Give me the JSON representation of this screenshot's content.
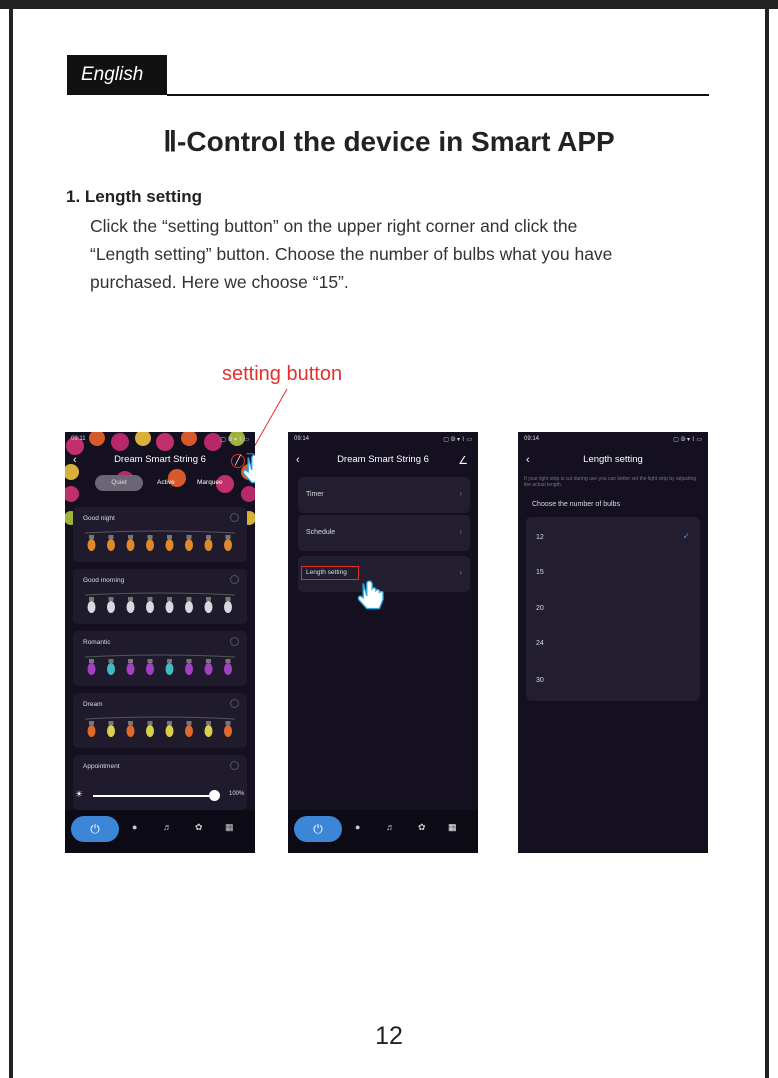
{
  "header": {
    "language": "English",
    "title": "Ⅱ-Control the device in Smart APP"
  },
  "section": {
    "heading": "1. Length setting",
    "lines": [
      "Click the  “setting button” on the upper right corner and click the",
      "“Length setting” button. Choose the number of bulbs what you have",
      "purchased. Here we choose  “15”."
    ]
  },
  "callout": {
    "label": "setting button"
  },
  "phone1": {
    "time": "09:11",
    "status_right": "▢ ⧁ ▾ ⌇ ▭",
    "title": "Dream Smart String 6",
    "tabs": [
      "Quiet",
      "Active",
      "Marquee"
    ],
    "scenes": [
      {
        "name": "Good night",
        "colors": [
          "#e0892c",
          "#e0892c",
          "#e0892c",
          "#e0892c",
          "#e0892c",
          "#e0892c",
          "#e0892c",
          "#e0892c"
        ]
      },
      {
        "name": "Good morning",
        "colors": [
          "#d8d8de",
          "#d8d8de",
          "#d8d8de",
          "#d8d8de",
          "#d8d8de",
          "#d8d8de",
          "#d8d8de",
          "#d8d8de"
        ]
      },
      {
        "name": "Romantic",
        "colors": [
          "#a53fc2",
          "#3fbcc2",
          "#a53fc2",
          "#a53fc2",
          "#3fbcc2",
          "#a53fc2",
          "#a53fc2",
          "#a53fc2"
        ]
      },
      {
        "name": "Dream",
        "colors": [
          "#e06a2c",
          "#d9d04b",
          "#e06a2c",
          "#d9d04b",
          "#d9d04b",
          "#e06a2c",
          "#d9d04b",
          "#e06a2c"
        ]
      },
      {
        "name": "Appointment",
        "colors": []
      }
    ],
    "brightness": "100%",
    "brightness_level": 1.0
  },
  "phone2": {
    "time": "09:14",
    "status_right": "▢ ⧁ ▾ ⌇ ▭",
    "title": "Dream Smart String 6",
    "menu": [
      "Timer",
      "Schedule",
      "Length setting"
    ]
  },
  "phone3": {
    "time": "09:14",
    "status_right": "▢ ⧁ ▾ ⌇ ▭",
    "title": "Length setting",
    "hint": "If your light strip is cut during use you can better set the light strip by adjusting the actual length.",
    "choose_label": "Choose the number of bulbs",
    "options": [
      "12",
      "15",
      "20",
      "24",
      "30"
    ],
    "selected": "12"
  },
  "page_number": "12"
}
